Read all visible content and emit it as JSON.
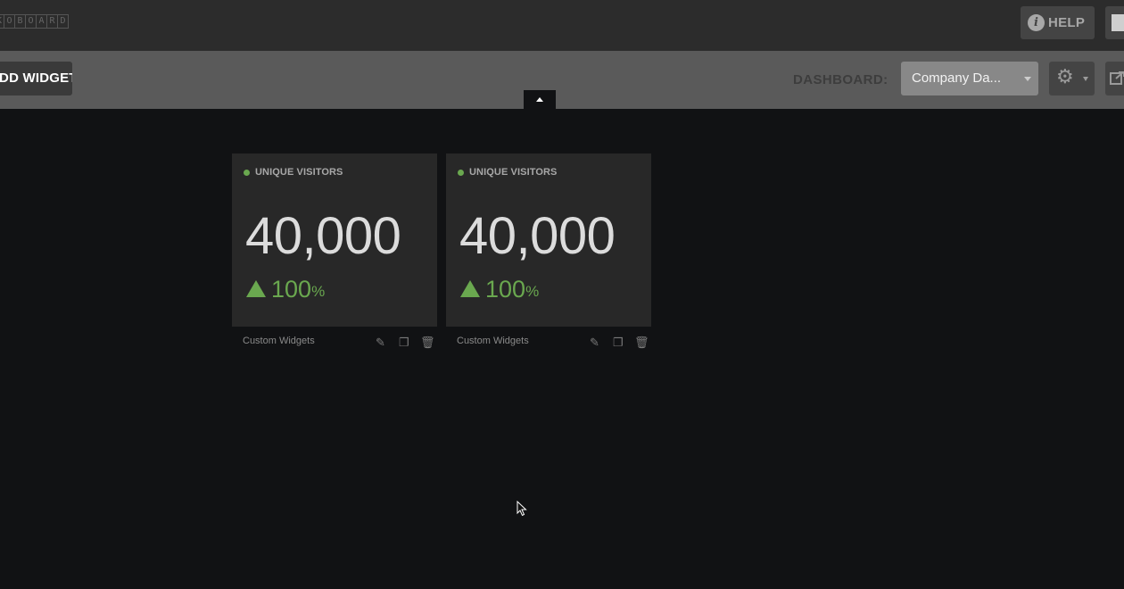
{
  "app": {
    "logo_letters": [
      "K",
      "O",
      "B",
      "O",
      "A",
      "R",
      "D"
    ]
  },
  "header": {
    "help_label": "HELP"
  },
  "toolbar": {
    "add_widget_label": "ADD WIDGET",
    "dashboard_label": "DASHBOARD:",
    "dashboard_selected": "Company Da..."
  },
  "widgets": [
    {
      "title": "UNIQUE VISITORS",
      "value": "40,000",
      "change": "100",
      "change_unit": "%",
      "source": "Custom Widgets"
    },
    {
      "title": "UNIQUE VISITORS",
      "value": "40,000",
      "change": "100",
      "change_unit": "%",
      "source": "Custom Widgets"
    }
  ],
  "colors": {
    "accent_green": "#6aa84f",
    "background": "#111214",
    "widget_bg": "#282828"
  },
  "icons": [
    "info-icon",
    "user-avatar-icon",
    "gear-icon",
    "share-icon",
    "collapse-arrow-icon",
    "pencil-icon",
    "copy-icon",
    "trash-icon",
    "cursor-icon"
  ]
}
